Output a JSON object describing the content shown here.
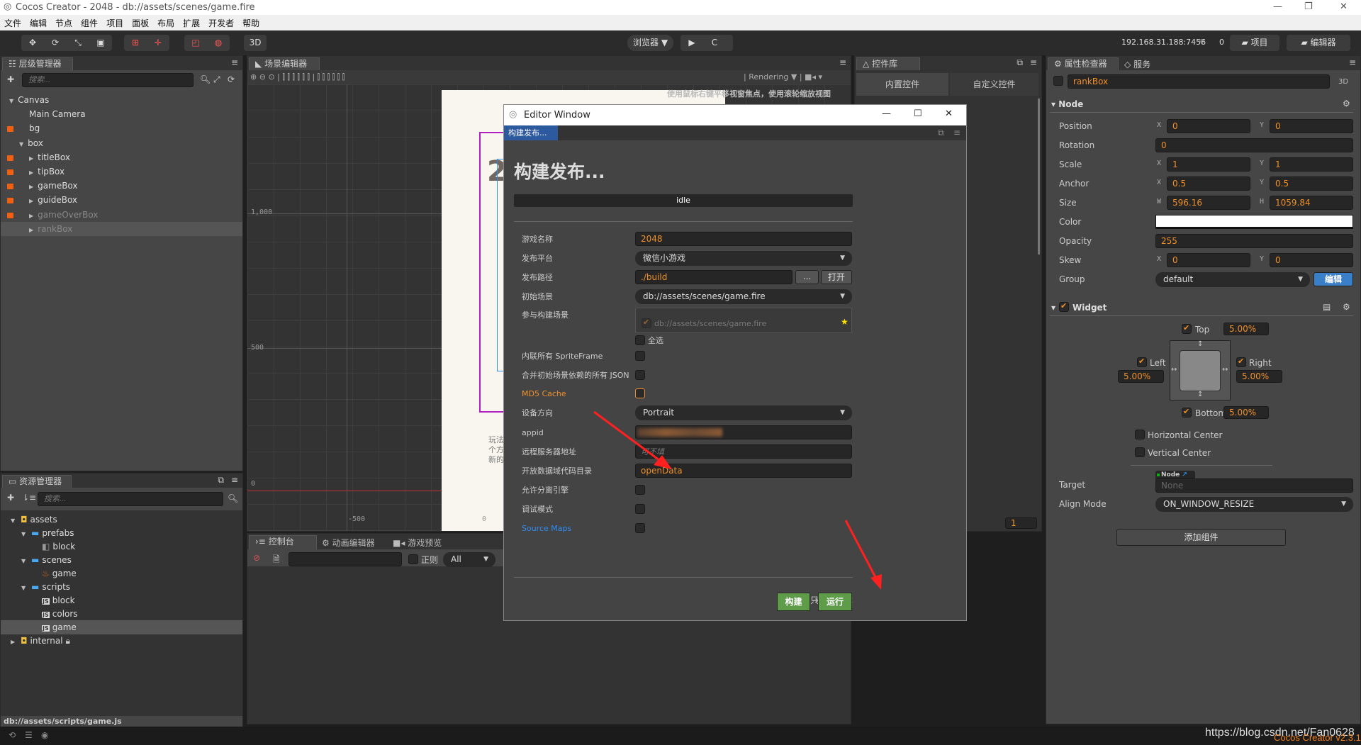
{
  "window": {
    "title": "Cocos Creator - 2048 - db://assets/scenes/game.fire",
    "controls": [
      "—",
      "❐",
      "✕"
    ]
  },
  "menu": [
    "文件",
    "编辑",
    "节点",
    "组件",
    "项目",
    "面板",
    "布局",
    "扩展",
    "开发者",
    "帮助"
  ],
  "toolbar": {
    "tools_3d": "3D",
    "browser": "浏览器 ▼",
    "play": "▶",
    "refresh": "C",
    "ip": "192.168.31.188:7456",
    "connections": "0",
    "project": "项目",
    "editor": "编辑器"
  },
  "hierarchy": {
    "tab": "层级管理器",
    "search_placeholder": "搜索...",
    "items": [
      {
        "label": "Canvas",
        "depth": 0,
        "caret": "▼",
        "locked": false,
        "dim": false
      },
      {
        "label": "Main Camera",
        "depth": 1,
        "caret": "",
        "locked": false,
        "dim": false
      },
      {
        "label": "bg",
        "depth": 1,
        "caret": "",
        "locked": true,
        "dim": false
      },
      {
        "label": "box",
        "depth": 1,
        "caret": "▼",
        "locked": false,
        "dim": false
      },
      {
        "label": "titleBox",
        "depth": 2,
        "caret": "▶",
        "locked": true,
        "dim": false
      },
      {
        "label": "tipBox",
        "depth": 2,
        "caret": "▶",
        "locked": true,
        "dim": false
      },
      {
        "label": "gameBox",
        "depth": 2,
        "caret": "▶",
        "locked": true,
        "dim": false
      },
      {
        "label": "guideBox",
        "depth": 2,
        "caret": "▶",
        "locked": true,
        "dim": false
      },
      {
        "label": "gameOverBox",
        "depth": 2,
        "caret": "▶",
        "locked": true,
        "dim": true
      },
      {
        "label": "rankBox",
        "depth": 2,
        "caret": "▶",
        "locked": false,
        "dim": true,
        "selected": true
      }
    ]
  },
  "assets": {
    "tab": "资源管理器",
    "search_placeholder": "搜索...",
    "status_path": "db://assets/scripts/game.js",
    "items": [
      {
        "label": "assets",
        "depth": 0,
        "icon": "db-icon",
        "caret": "▼"
      },
      {
        "label": "prefabs",
        "depth": 1,
        "icon": "folder-icon",
        "caret": "▼"
      },
      {
        "label": "block",
        "depth": 2,
        "icon": "prefab-icon",
        "caret": ""
      },
      {
        "label": "scenes",
        "depth": 1,
        "icon": "folder-icon",
        "caret": "▼"
      },
      {
        "label": "game",
        "depth": 2,
        "icon": "fire-icon",
        "caret": ""
      },
      {
        "label": "scripts",
        "depth": 1,
        "icon": "folder-icon",
        "caret": "▼"
      },
      {
        "label": "block",
        "depth": 2,
        "icon": "js-icon",
        "caret": ""
      },
      {
        "label": "colors",
        "depth": 2,
        "icon": "js-icon",
        "caret": ""
      },
      {
        "label": "game",
        "depth": 2,
        "icon": "js-icon",
        "caret": "",
        "selected": true
      },
      {
        "label": "internal",
        "depth": 0,
        "icon": "db-icon",
        "caret": "▶",
        "locked": true
      }
    ]
  },
  "scene": {
    "tab": "场景编辑器",
    "rendering": "Rendering ▼",
    "hint": "使用鼠标右键平移视窗焦点，使用滚轮缩放视图",
    "y_labels": [
      "1,000",
      "500",
      "0"
    ],
    "x_labels": [
      "-500",
      "0"
    ],
    "canvas_number": "2",
    "canvas_text": [
      "玩法",
      "个方",
      "新的"
    ],
    "zoom_value": "1"
  },
  "console": {
    "tabs": [
      "控制台",
      "动画编辑器",
      "游戏预览"
    ],
    "regex": "正则",
    "level": "All"
  },
  "library": {
    "tab": "控件库",
    "tabs": [
      "内置控件",
      "自定义控件"
    ]
  },
  "inspector": {
    "tabs": [
      "属性检查器",
      "服务"
    ],
    "node_name": "rankBox",
    "mode": "3D",
    "node_section": "Node",
    "props": {
      "position": {
        "label": "Position",
        "x": "0",
        "y": "0"
      },
      "rotation": {
        "label": "Rotation",
        "value": "0"
      },
      "scale": {
        "label": "Scale",
        "x": "1",
        "y": "1"
      },
      "anchor": {
        "label": "Anchor",
        "x": "0.5",
        "y": "0.5"
      },
      "size": {
        "label": "Size",
        "w": "596.16",
        "h": "1059.84"
      },
      "color": {
        "label": "Color",
        "value": "#ffffff"
      },
      "opacity": {
        "label": "Opacity",
        "value": "255"
      },
      "skew": {
        "label": "Skew",
        "x": "0",
        "y": "0"
      },
      "group": {
        "label": "Group",
        "value": "default",
        "edit": "编辑"
      }
    },
    "widget": {
      "title": "Widget",
      "top": {
        "label": "Top",
        "value": "5.00%"
      },
      "left": {
        "label": "Left",
        "value": "5.00%"
      },
      "right": {
        "label": "Right",
        "value": "5.00%"
      },
      "bottom": {
        "label": "Bottom",
        "value": "5.00%"
      },
      "hcenter": "Horizontal Center",
      "vcenter": "Vertical Center",
      "target_label": "Target",
      "target_tag": "Node",
      "target_value": "None",
      "align_label": "Align Mode",
      "align_value": "ON_WINDOW_RESIZE"
    },
    "add_component": "添加组件"
  },
  "dialog": {
    "title": "Editor Window",
    "tab": "构建发布...",
    "heading": "构建发布...",
    "status": "idle",
    "fields": {
      "game_name": {
        "label": "游戏名称",
        "value": "2048"
      },
      "platform": {
        "label": "发布平台",
        "value": "微信小游戏"
      },
      "path": {
        "label": "发布路径",
        "value": "./build",
        "browse": "...",
        "open": "打开"
      },
      "start_scene": {
        "label": "初始场景",
        "value": "db://assets/scenes/game.fire"
      },
      "scenes": {
        "label": "参与构建场景",
        "value": "db://assets/scenes/game.fire",
        "select_all": "全选"
      },
      "inline_sprite": {
        "label": "内联所有 SpriteFrame"
      },
      "merge_json": {
        "label": "合并初始场景依赖的所有 JSON"
      },
      "md5": {
        "label": "MD5 Cache"
      },
      "orientation": {
        "label": "设备方向",
        "value": "Portrait"
      },
      "appid": {
        "label": "appid"
      },
      "remote": {
        "label": "远程服务器地址",
        "placeholder": "可不填"
      },
      "open_data": {
        "label": "开放数据域代码目录",
        "value": "openData"
      },
      "separate_engine": {
        "label": "允许分离引擎"
      },
      "debug": {
        "label": "调试模式"
      },
      "source_maps": {
        "label": "Source Maps"
      }
    },
    "only_script": "只构建脚本",
    "build": "构建",
    "run": "运行"
  },
  "footer": {
    "watermark": "https://blog.csdn.net/Fan0628",
    "version": "Cocos Creator v2.3.1"
  },
  "colors": {
    "accent": "#f0902a",
    "link": "#2e8cf0",
    "build_green": "#5e9c4a",
    "arrow": "#ff2020",
    "lock": "#f06010"
  }
}
